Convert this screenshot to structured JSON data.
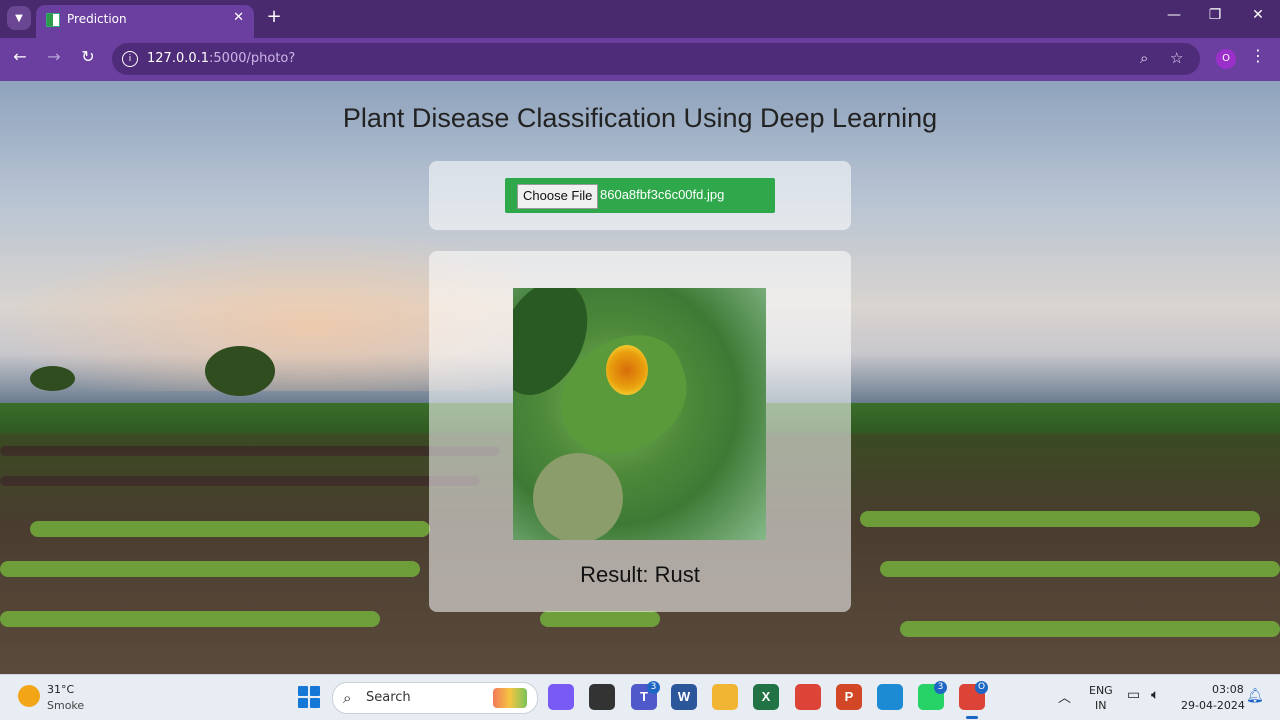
{
  "browser": {
    "tab_title": "Prediction",
    "tab_close": "✕",
    "new_tab": "+",
    "url_host": "127.0.0.1",
    "url_path": ":5000/photo?",
    "profile_initial": "O",
    "window_controls": [
      "—",
      "❐",
      "✕"
    ]
  },
  "page": {
    "heading": "Plant Disease Classification Using Deep Learning",
    "choose_file_label": "Choose File",
    "file_name": "860a8fbf3c6c00fd.jpg",
    "result": "Result: Rust"
  },
  "taskbar": {
    "weather_temp": "31°C",
    "weather_desc": "Smoke",
    "search_label": "Search",
    "apps": [
      {
        "name": "copilot",
        "label": "",
        "color": "#7a5af5"
      },
      {
        "name": "files",
        "label": "",
        "color": "#333333"
      },
      {
        "name": "teams",
        "label": "T",
        "color": "#5059c9",
        "badge": "3"
      },
      {
        "name": "word",
        "label": "W",
        "color": "#2b579a"
      },
      {
        "name": "explorer",
        "label": "",
        "color": "#f2b533"
      },
      {
        "name": "excel",
        "label": "X",
        "color": "#217346"
      },
      {
        "name": "chrome",
        "label": "",
        "color": "#db4437"
      },
      {
        "name": "powerpoint",
        "label": "P",
        "color": "#d24726"
      },
      {
        "name": "vscode",
        "label": "",
        "color": "#1d8bd3"
      },
      {
        "name": "whatsapp",
        "label": "",
        "color": "#25d366",
        "badge": "3"
      },
      {
        "name": "chrome-profile",
        "label": "",
        "color": "#db4437",
        "badge": "O"
      }
    ],
    "lang_line1": "ENG",
    "lang_line2": "IN",
    "time": "03:08",
    "date": "29-04-2024"
  },
  "colors": {
    "tab_bar": "#4a2a6e",
    "toolbar": "#6a3fa0",
    "upload_bar": "#2ea84a",
    "taskbar": "#e8edf3"
  }
}
